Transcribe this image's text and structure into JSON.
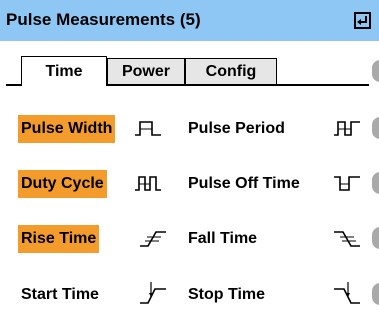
{
  "header": {
    "title": "Pulse Measurements (5)",
    "enter_icon": "enter-key-icon"
  },
  "tabs": [
    {
      "label": "Time",
      "selected": true
    },
    {
      "label": "Power",
      "selected": false
    },
    {
      "label": "Config",
      "selected": false
    }
  ],
  "measurements": [
    {
      "label": "Pulse Width",
      "selected": true,
      "icon": "pulse-width-icon"
    },
    {
      "label": "Pulse Period",
      "selected": false,
      "icon": "pulse-period-icon"
    },
    {
      "label": "Duty Cycle",
      "selected": true,
      "icon": "duty-cycle-icon"
    },
    {
      "label": "Pulse Off Time",
      "selected": false,
      "icon": "pulse-off-time-icon"
    },
    {
      "label": "Rise Time",
      "selected": true,
      "icon": "rise-time-icon"
    },
    {
      "label": "Fall Time",
      "selected": false,
      "icon": "fall-time-icon"
    },
    {
      "label": "Start Time",
      "selected": false,
      "icon": "start-time-icon"
    },
    {
      "label": "Stop Time",
      "selected": false,
      "icon": "stop-time-icon"
    }
  ],
  "colors": {
    "header_bg": "#8fc7f4",
    "selected_bg": "#f39c2b",
    "inactive_tab_bg": "#e6e6e6"
  }
}
